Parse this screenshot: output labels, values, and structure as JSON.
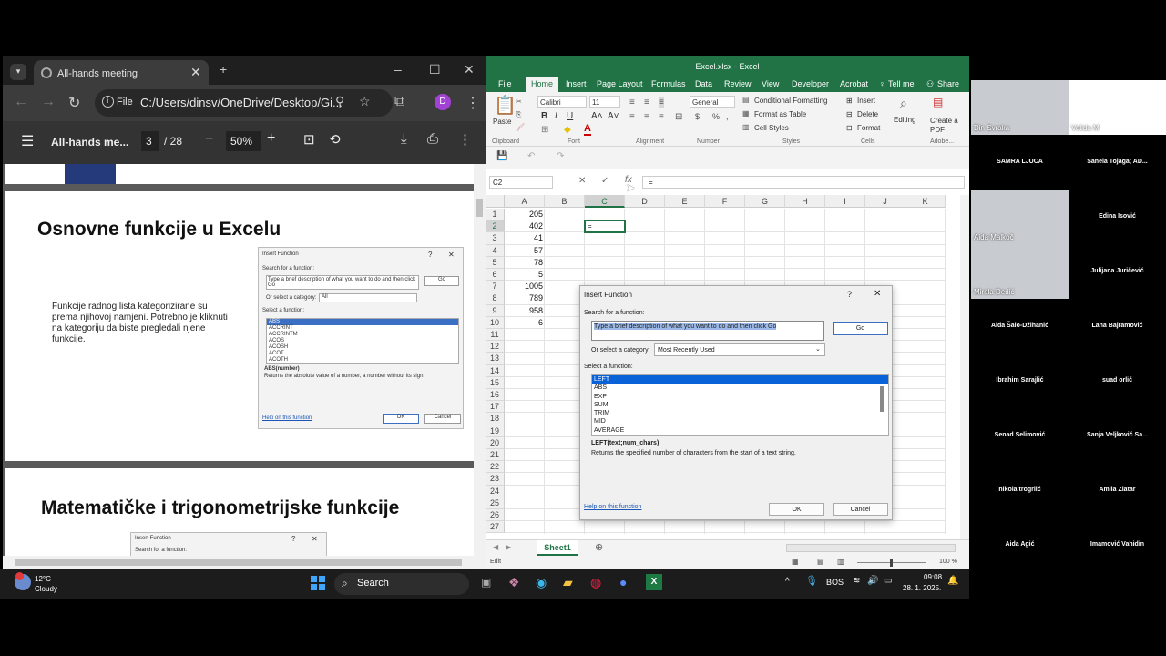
{
  "browser": {
    "tab_title": "All-hands meeting",
    "file_badge": "File",
    "url": "C:/Users/dinsv/OneDrive/Desktop/Gi...",
    "profile_initial": "D"
  },
  "pdf": {
    "doc_title": "All-hands me...",
    "page_current": "3",
    "page_total": "/ 28",
    "zoom": "50%",
    "slide1_heading": "Osnovne funkcije u Excelu",
    "slide1_body": "Funkcije radnog lista kategorizirane su prema njihovoj namjeni. Potrebno je kliknuti na kategoriju da biste pregledali njene funkcije.",
    "slide2_heading": "Matematičke i trigonometrijske funkcije",
    "mini_dialog": {
      "title": "Insert Function",
      "search_label": "Search for a function:",
      "search_text": "Type a brief description of what you want to do and then click Go",
      "go": "Go",
      "category_label": "Or select a category:",
      "category_value": "All",
      "select_label": "Select a function:",
      "functions": [
        "ABS",
        "ACCRINT",
        "ACCRINTM",
        "ACOS",
        "ACOSH",
        "ACOT",
        "ACOTH"
      ],
      "signature": "ABS(number)",
      "description": "Returns the absolute value of a number, a number without its sign.",
      "help": "Help on this function",
      "ok": "OK",
      "cancel": "Cancel"
    },
    "mini_dialog2": {
      "title": "Insert Function",
      "search_label": "Search for a function:"
    }
  },
  "excel": {
    "title": "Excel.xlsx - Excel",
    "tabs": [
      "File",
      "Home",
      "Insert",
      "Page Layout",
      "Formulas",
      "Data",
      "Review",
      "View",
      "Developer",
      "Acrobat",
      "Tell me",
      "Share"
    ],
    "ribbon": {
      "paste": "Paste",
      "font_name": "Calibri",
      "font_size": "11",
      "number_format": "General",
      "cond_format": "Conditional Formatting",
      "format_table": "Format as Table",
      "cell_styles": "Cell Styles",
      "insert": "Insert",
      "delete": "Delete",
      "format": "Format",
      "editing": "Editing",
      "create_pdf": "Create a PDF",
      "groups": [
        "Clipboard",
        "Font",
        "Alignment",
        "Number",
        "Styles",
        "Cells",
        "Adobe..."
      ]
    },
    "name_box": "C2",
    "formula": "=",
    "columns": [
      "A",
      "B",
      "C",
      "D",
      "E",
      "F",
      "G",
      "H",
      "I",
      "J",
      "K"
    ],
    "rows": [
      "1",
      "2",
      "3",
      "4",
      "5",
      "6",
      "7",
      "8",
      "9",
      "10",
      "11",
      "12",
      "13",
      "14",
      "15",
      "16",
      "17",
      "18",
      "19",
      "20",
      "21",
      "22",
      "23",
      "24",
      "25",
      "26",
      "27"
    ],
    "colA": [
      "205",
      "402",
      "41",
      "57",
      "78",
      "5",
      "1005",
      "789",
      "958",
      "6"
    ],
    "active_cell_value": "=",
    "sheet_tab": "Sheet1",
    "status_mode": "Edit",
    "zoom": "100 %"
  },
  "insert_dialog": {
    "title": "Insert Function",
    "search_label": "Search for a function:",
    "search_text": "Type a brief description of what you want to do and then click Go",
    "go": "Go",
    "category_label": "Or select a category:",
    "category_value": "Most Recently Used",
    "select_label": "Select a function:",
    "functions": [
      "LEFT",
      "ABS",
      "EXP",
      "SUM",
      "TRIM",
      "MID",
      "AVERAGE"
    ],
    "signature": "LEFT(text;num_chars)",
    "description": "Returns the specified number of characters from the start of a text string.",
    "help": "Help on this function",
    "ok": "OK",
    "cancel": "Cancel"
  },
  "participants": [
    {
      "name": "Din Svraka",
      "video": true
    },
    {
      "name": "Velida M",
      "video": true
    },
    {
      "name": "SAMRA LJUCA",
      "video": false
    },
    {
      "name": "Sanela Tojaga; AD...",
      "video": false
    },
    {
      "name": "Aida Malkoč",
      "video": true
    },
    {
      "name": "Edina Isović",
      "video": false
    },
    {
      "name": "Mirela Dedić",
      "video": true
    },
    {
      "name": "Julijana Juričević",
      "video": false
    },
    {
      "name": "Aida Šalo-Džihanić",
      "video": false
    },
    {
      "name": "Lana Bajramović",
      "video": false
    },
    {
      "name": "Ibrahim Sarajlić",
      "video": false
    },
    {
      "name": "suad orlić",
      "video": false
    },
    {
      "name": "Senad Selimović",
      "video": false
    },
    {
      "name": "Sanja Veljković Sa...",
      "video": false
    },
    {
      "name": "nikola trogrlić",
      "video": false
    },
    {
      "name": "Amila Zlatar",
      "video": false
    },
    {
      "name": "Aida Agić",
      "video": false
    },
    {
      "name": "Imamović Vahidin",
      "video": false
    }
  ],
  "taskbar": {
    "weather_temp": "12°C",
    "weather_desc": "Cloudy",
    "search": "Search",
    "lang": "BOS",
    "time": "09:08",
    "date": "28. 1. 2025."
  }
}
